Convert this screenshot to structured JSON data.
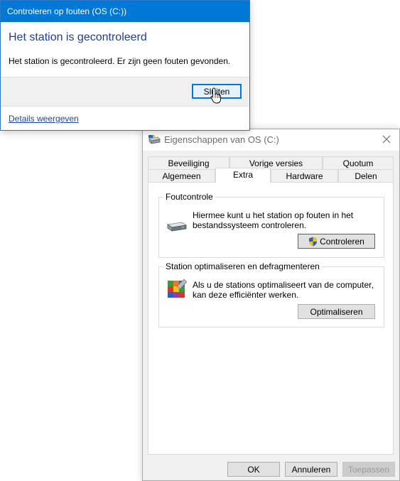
{
  "check_dialog": {
    "title": "Controleren op fouten (OS (C:))",
    "heading": "Het station is gecontroleerd",
    "message": "Het station is gecontroleerd. Er zijn geen fouten gevonden.",
    "close_label": "Sluiten",
    "details_link": "Details weergeven",
    "titlebar_color": "#0078d7",
    "heading_color": "#1c3f95"
  },
  "properties_window": {
    "title": "Eigenschappen van OS (C:)",
    "tabs_row1": [
      "Beveiliging",
      "Vorige versies",
      "Quotum"
    ],
    "tabs_row2": [
      "Algemeen",
      "Extra",
      "Hardware",
      "Delen"
    ],
    "active_tab": "Extra",
    "error_check": {
      "label": "Foutcontrole",
      "line1": "Hiermee kunt u het station op fouten in het",
      "line2": "bestandssysteem controleren.",
      "button": "Controleren",
      "icon": "drive-icon",
      "button_icon": "uac-shield-icon"
    },
    "optimize": {
      "label": "Station optimaliseren en defragmenteren",
      "line1": "Als u de stations optimaliseert van de computer,",
      "line2": "kan deze efficiënter werken.",
      "button": "Optimaliseren",
      "icon": "defrag-icon"
    },
    "buttons": {
      "ok": "OK",
      "cancel": "Annuleren",
      "apply": "Toepassen"
    }
  }
}
